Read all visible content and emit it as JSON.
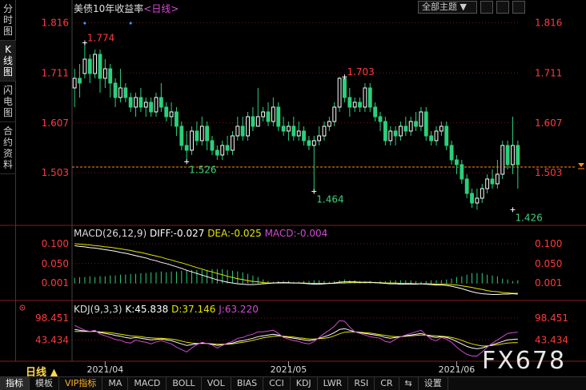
{
  "sidebar": {
    "tabs": [
      {
        "label": "分时图",
        "active": false
      },
      {
        "label": "K线图",
        "active": true
      },
      {
        "label": "闪电图",
        "active": false
      },
      {
        "label": "合约资料",
        "active": false
      }
    ]
  },
  "header": {
    "title": "美债10年收益率",
    "period": "<日线>",
    "theme_select": "全部主题"
  },
  "colors": {
    "up": "#2bd07a",
    "down": "#2bd07a",
    "up_stroke": "#ffffff",
    "price_label": "#ff3b3b",
    "low_label": "#3fd07a",
    "dif": "#ffffff",
    "dea": "#e6e600",
    "macd": "#d04bd0",
    "k": "#ffffff",
    "d": "#e6e600",
    "j": "#d04bd0",
    "grid": "#7a1414",
    "last_price_line": "#ff8c1a"
  },
  "chart_data": {
    "type": "candlestick",
    "title": "美债10年收益率",
    "y_ticks": [
      "1.816",
      "1.711",
      "1.607",
      "1.503"
    ],
    "ylim": [
      1.41,
      1.83
    ],
    "x_ticks": [
      "2021/04",
      "2021/05",
      "2021/06"
    ],
    "x_tick_positions": [
      6,
      42,
      75
    ],
    "last_price_label": "1.503",
    "last_price": 1.515,
    "markers": [
      {
        "label": "1.774",
        "index": 2,
        "value": 1.774,
        "kind": "high"
      },
      {
        "label": "1.526",
        "index": 22,
        "value": 1.526,
        "kind": "low"
      },
      {
        "label": "1.703",
        "index": 53,
        "value": 1.703,
        "kind": "high"
      },
      {
        "label": "1.464",
        "index": 47,
        "value": 1.464,
        "kind": "low"
      },
      {
        "label": "1.426",
        "index": 86,
        "value": 1.426,
        "kind": "low"
      }
    ],
    "candles": [
      [
        1.68,
        1.7,
        1.72,
        1.64
      ],
      [
        1.7,
        1.69,
        1.73,
        1.66
      ],
      [
        1.71,
        1.74,
        1.774,
        1.7
      ],
      [
        1.74,
        1.71,
        1.75,
        1.69
      ],
      [
        1.71,
        1.75,
        1.76,
        1.7
      ],
      [
        1.75,
        1.7,
        1.76,
        1.67
      ],
      [
        1.7,
        1.72,
        1.74,
        1.68
      ],
      [
        1.72,
        1.69,
        1.73,
        1.66
      ],
      [
        1.69,
        1.66,
        1.7,
        1.64
      ],
      [
        1.66,
        1.68,
        1.72,
        1.65
      ],
      [
        1.68,
        1.66,
        1.69,
        1.65
      ],
      [
        1.66,
        1.64,
        1.67,
        1.63
      ],
      [
        1.64,
        1.66,
        1.67,
        1.62
      ],
      [
        1.66,
        1.64,
        1.68,
        1.63
      ],
      [
        1.64,
        1.65,
        1.66,
        1.62
      ],
      [
        1.65,
        1.63,
        1.66,
        1.62
      ],
      [
        1.63,
        1.66,
        1.67,
        1.62
      ],
      [
        1.66,
        1.64,
        1.69,
        1.63
      ],
      [
        1.64,
        1.62,
        1.65,
        1.61
      ],
      [
        1.62,
        1.63,
        1.65,
        1.6
      ],
      [
        1.63,
        1.6,
        1.64,
        1.58
      ],
      [
        1.6,
        1.56,
        1.61,
        1.55
      ],
      [
        1.56,
        1.55,
        1.59,
        1.526
      ],
      [
        1.55,
        1.59,
        1.6,
        1.54
      ],
      [
        1.59,
        1.57,
        1.61,
        1.56
      ],
      [
        1.57,
        1.6,
        1.62,
        1.56
      ],
      [
        1.6,
        1.57,
        1.61,
        1.55
      ],
      [
        1.57,
        1.55,
        1.58,
        1.54
      ],
      [
        1.55,
        1.54,
        1.56,
        1.53
      ],
      [
        1.54,
        1.56,
        1.57,
        1.53
      ],
      [
        1.56,
        1.55,
        1.58,
        1.54
      ],
      [
        1.55,
        1.58,
        1.59,
        1.54
      ],
      [
        1.58,
        1.6,
        1.62,
        1.57
      ],
      [
        1.6,
        1.58,
        1.62,
        1.57
      ],
      [
        1.58,
        1.62,
        1.63,
        1.57
      ],
      [
        1.62,
        1.6,
        1.64,
        1.59
      ],
      [
        1.6,
        1.62,
        1.68,
        1.6
      ],
      [
        1.62,
        1.63,
        1.64,
        1.61
      ],
      [
        1.63,
        1.61,
        1.65,
        1.6
      ],
      [
        1.61,
        1.64,
        1.66,
        1.6
      ],
      [
        1.64,
        1.6,
        1.65,
        1.59
      ],
      [
        1.6,
        1.59,
        1.62,
        1.58
      ],
      [
        1.59,
        1.6,
        1.61,
        1.57
      ],
      [
        1.6,
        1.58,
        1.62,
        1.57
      ],
      [
        1.58,
        1.59,
        1.61,
        1.57
      ],
      [
        1.59,
        1.57,
        1.6,
        1.56
      ],
      [
        1.57,
        1.56,
        1.58,
        1.55
      ],
      [
        1.56,
        1.57,
        1.58,
        1.464
      ],
      [
        1.57,
        1.58,
        1.6,
        1.56
      ],
      [
        1.58,
        1.6,
        1.61,
        1.57
      ],
      [
        1.6,
        1.61,
        1.62,
        1.59
      ],
      [
        1.61,
        1.64,
        1.65,
        1.6
      ],
      [
        1.64,
        1.7,
        1.703,
        1.63
      ],
      [
        1.7,
        1.66,
        1.703,
        1.65
      ],
      [
        1.66,
        1.64,
        1.68,
        1.62
      ],
      [
        1.64,
        1.65,
        1.66,
        1.63
      ],
      [
        1.65,
        1.64,
        1.66,
        1.63
      ],
      [
        1.64,
        1.68,
        1.69,
        1.63
      ],
      [
        1.68,
        1.64,
        1.69,
        1.63
      ],
      [
        1.64,
        1.62,
        1.65,
        1.61
      ],
      [
        1.62,
        1.61,
        1.63,
        1.59
      ],
      [
        1.61,
        1.57,
        1.62,
        1.56
      ],
      [
        1.57,
        1.59,
        1.6,
        1.56
      ],
      [
        1.59,
        1.58,
        1.6,
        1.56
      ],
      [
        1.58,
        1.6,
        1.61,
        1.57
      ],
      [
        1.6,
        1.59,
        1.62,
        1.58
      ],
      [
        1.59,
        1.61,
        1.62,
        1.58
      ],
      [
        1.61,
        1.6,
        1.63,
        1.59
      ],
      [
        1.6,
        1.63,
        1.64,
        1.59
      ],
      [
        1.63,
        1.58,
        1.64,
        1.57
      ],
      [
        1.58,
        1.57,
        1.59,
        1.56
      ],
      [
        1.57,
        1.59,
        1.6,
        1.56
      ],
      [
        1.59,
        1.6,
        1.61,
        1.58
      ],
      [
        1.6,
        1.56,
        1.61,
        1.55
      ],
      [
        1.56,
        1.53,
        1.57,
        1.52
      ],
      [
        1.53,
        1.52,
        1.54,
        1.5
      ],
      [
        1.52,
        1.49,
        1.53,
        1.48
      ],
      [
        1.49,
        1.46,
        1.5,
        1.45
      ],
      [
        1.46,
        1.44,
        1.47,
        1.43
      ],
      [
        1.44,
        1.45,
        1.47,
        1.426
      ],
      [
        1.45,
        1.47,
        1.48,
        1.44
      ],
      [
        1.47,
        1.49,
        1.5,
        1.46
      ],
      [
        1.49,
        1.48,
        1.51,
        1.47
      ],
      [
        1.48,
        1.5,
        1.53,
        1.47
      ],
      [
        1.5,
        1.56,
        1.57,
        1.49
      ],
      [
        1.56,
        1.52,
        1.57,
        1.51
      ],
      [
        1.52,
        1.56,
        1.62,
        1.5
      ],
      [
        1.56,
        1.52,
        1.57,
        1.47
      ]
    ]
  },
  "macd": {
    "label": "MACD(26,12,9)",
    "diff_label": "DIFF:",
    "diff": "-0.027",
    "dea_label": "DEA:",
    "dea": "-0.025",
    "macd_label": "MACD:",
    "macd": "-0.004",
    "y_ticks": [
      "0.100",
      "0.050",
      "0.001"
    ],
    "ylim": [
      -0.035,
      0.11
    ],
    "dif_series": [
      0.095,
      0.093,
      0.092,
      0.09,
      0.089,
      0.087,
      0.085,
      0.083,
      0.081,
      0.078,
      0.076,
      0.073,
      0.07,
      0.067,
      0.064,
      0.06,
      0.057,
      0.053,
      0.05,
      0.046,
      0.042,
      0.038,
      0.033,
      0.029,
      0.025,
      0.021,
      0.017,
      0.013,
      0.009,
      0.006,
      0.003,
      0.001,
      -0.001,
      -0.002,
      -0.003,
      -0.003,
      -0.002,
      -0.001,
      0.0,
      0.001,
      0.002,
      0.002,
      0.002,
      0.001,
      0.001,
      0.0,
      -0.001,
      -0.002,
      -0.002,
      -0.001,
      0.0,
      0.001,
      0.003,
      0.004,
      0.004,
      0.004,
      0.003,
      0.003,
      0.003,
      0.002,
      0.001,
      0.0,
      -0.001,
      -0.001,
      -0.002,
      -0.002,
      -0.002,
      -0.002,
      -0.001,
      -0.002,
      -0.003,
      -0.004,
      -0.004,
      -0.005,
      -0.007,
      -0.01,
      -0.013,
      -0.017,
      -0.021,
      -0.024,
      -0.026,
      -0.027,
      -0.028,
      -0.028,
      -0.027,
      -0.027,
      -0.026,
      -0.027
    ],
    "dea_series": [
      0.1,
      0.099,
      0.098,
      0.097,
      0.095,
      0.094,
      0.092,
      0.091,
      0.089,
      0.087,
      0.085,
      0.083,
      0.08,
      0.078,
      0.075,
      0.072,
      0.069,
      0.066,
      0.062,
      0.059,
      0.055,
      0.052,
      0.048,
      0.044,
      0.04,
      0.036,
      0.032,
      0.029,
      0.025,
      0.022,
      0.018,
      0.015,
      0.012,
      0.01,
      0.007,
      0.005,
      0.004,
      0.002,
      0.001,
      0.001,
      0.001,
      0.001,
      0.001,
      0.001,
      0.001,
      0.001,
      0.0,
      0.0,
      0.0,
      0.0,
      0.0,
      0.0,
      0.001,
      0.001,
      0.002,
      0.002,
      0.002,
      0.002,
      0.002,
      0.002,
      0.002,
      0.001,
      0.001,
      0.001,
      0.0,
      0.0,
      0.0,
      -0.001,
      -0.001,
      -0.001,
      -0.001,
      -0.002,
      -0.002,
      -0.002,
      -0.003,
      -0.004,
      -0.006,
      -0.008,
      -0.01,
      -0.013,
      -0.015,
      -0.018,
      -0.02,
      -0.021,
      -0.023,
      -0.024,
      -0.025,
      -0.025
    ]
  },
  "kdj": {
    "label": "KDJ(9,3,3)",
    "k_label": "K:",
    "k": "45.838",
    "d_label": "D:",
    "d": "37.146",
    "j_label": "J:",
    "j": "63.220",
    "y_ticks": [
      "98.451",
      "43.434"
    ],
    "ylim": [
      -5,
      110
    ],
    "k_series": [
      70,
      68,
      66,
      65,
      66,
      62,
      60,
      58,
      55,
      53,
      50,
      48,
      50,
      48,
      46,
      44,
      45,
      46,
      44,
      42,
      38,
      34,
      30,
      32,
      34,
      36,
      35,
      33,
      30,
      32,
      34,
      36,
      40,
      42,
      45,
      48,
      52,
      54,
      56,
      58,
      56,
      52,
      50,
      48,
      46,
      44,
      42,
      44,
      48,
      52,
      56,
      62,
      70,
      72,
      68,
      64,
      62,
      60,
      58,
      56,
      54,
      50,
      48,
      50,
      52,
      54,
      56,
      58,
      60,
      56,
      52,
      50,
      52,
      50,
      46,
      40,
      34,
      28,
      24,
      22,
      24,
      28,
      32,
      36,
      40,
      44,
      45,
      46
    ],
    "d_series": [
      65,
      65,
      65,
      65,
      65,
      64,
      63,
      62,
      60,
      58,
      56,
      54,
      53,
      52,
      50,
      49,
      48,
      48,
      47,
      46,
      44,
      41,
      38,
      36,
      35,
      35,
      35,
      34,
      33,
      33,
      33,
      34,
      36,
      38,
      40,
      43,
      46,
      49,
      51,
      53,
      54,
      53,
      52,
      51,
      49,
      48,
      46,
      46,
      47,
      48,
      50,
      54,
      59,
      63,
      64,
      64,
      63,
      62,
      61,
      59,
      57,
      55,
      53,
      52,
      52,
      53,
      54,
      55,
      56,
      56,
      55,
      54,
      53,
      52,
      50,
      47,
      43,
      38,
      34,
      31,
      29,
      29,
      30,
      32,
      34,
      36,
      37,
      37
    ],
    "j_series": [
      80,
      74,
      68,
      65,
      68,
      58,
      54,
      50,
      45,
      43,
      38,
      36,
      44,
      40,
      38,
      34,
      39,
      42,
      38,
      34,
      26,
      20,
      14,
      24,
      32,
      38,
      35,
      31,
      24,
      30,
      36,
      40,
      48,
      50,
      55,
      58,
      64,
      64,
      66,
      68,
      60,
      50,
      46,
      42,
      40,
      36,
      34,
      40,
      50,
      60,
      68,
      78,
      92,
      90,
      76,
      64,
      60,
      56,
      52,
      50,
      48,
      40,
      38,
      46,
      52,
      56,
      60,
      64,
      68,
      56,
      46,
      42,
      50,
      46,
      38,
      26,
      16,
      8,
      4,
      4,
      14,
      26,
      36,
      44,
      52,
      60,
      62,
      63
    ]
  },
  "bottom": {
    "period_btn": "日线 ▲",
    "tabs": [
      {
        "label": "指标",
        "active": true,
        "vip": false
      },
      {
        "label": "模板",
        "active": false,
        "vip": false
      },
      {
        "label": "VIP指标",
        "active": false,
        "vip": true
      },
      {
        "label": "MA",
        "active": false,
        "vip": false
      },
      {
        "label": "MACD",
        "active": false,
        "vip": false
      },
      {
        "label": "BOLL",
        "active": false,
        "vip": false
      },
      {
        "label": "VOL",
        "active": false,
        "vip": false
      },
      {
        "label": "BIAS",
        "active": false,
        "vip": false
      },
      {
        "label": "CCI",
        "active": false,
        "vip": false
      },
      {
        "label": "KDJ",
        "active": false,
        "vip": false
      },
      {
        "label": "LWR",
        "active": false,
        "vip": false
      },
      {
        "label": "RSI",
        "active": false,
        "vip": false
      },
      {
        "label": "CR",
        "active": false,
        "vip": false
      },
      {
        "label": "⇆",
        "active": false,
        "vip": false
      },
      {
        "label": "设置",
        "active": false,
        "vip": false
      }
    ]
  },
  "watermark": "FX678"
}
